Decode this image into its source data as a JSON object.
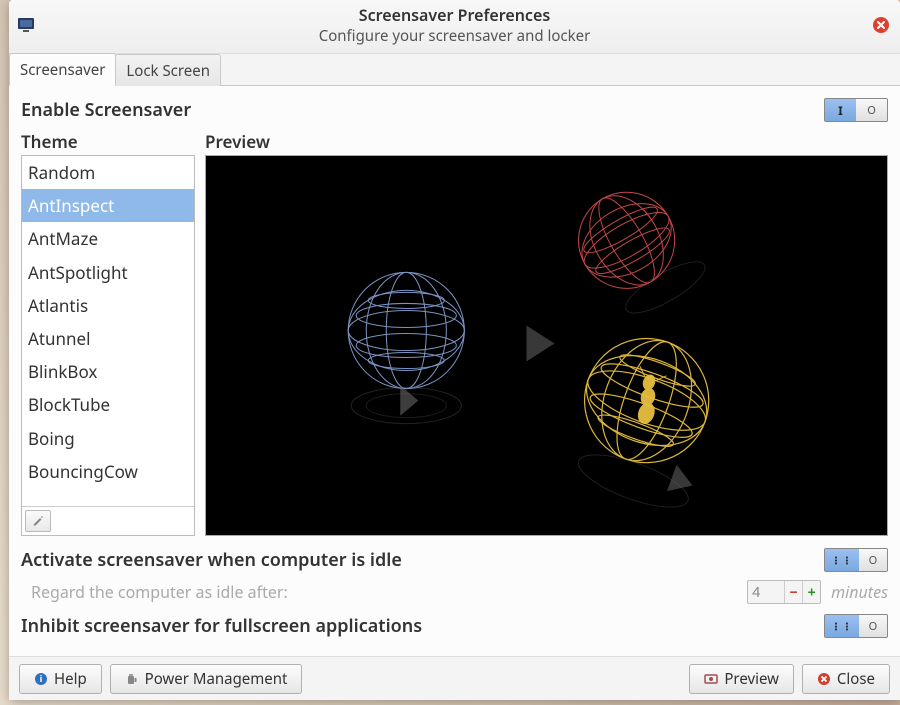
{
  "window": {
    "title": "Screensaver Preferences",
    "subtitle": "Configure your screensaver and locker"
  },
  "tabs": [
    {
      "label": "Screensaver",
      "active": true
    },
    {
      "label": "Lock Screen",
      "active": false
    }
  ],
  "enable": {
    "label": "Enable Screensaver",
    "value": true,
    "on_glyph": "I",
    "off_glyph": "O"
  },
  "theme": {
    "header": "Theme",
    "items": [
      "Random",
      "AntInspect",
      "AntMaze",
      "AntSpotlight",
      "Atlantis",
      "Atunnel",
      "BlinkBox",
      "BlockTube",
      "Boing",
      "BouncingCow"
    ],
    "selected_index": 1
  },
  "preview": {
    "header": "Preview"
  },
  "idle": {
    "activate_label": "Activate screensaver when computer is idle",
    "activate_value": false,
    "regard_label": "Regard the computer as idle after:",
    "minutes_value": "4",
    "minutes_unit": "minutes"
  },
  "inhibit": {
    "label": "Inhibit screensaver for fullscreen applications",
    "value": false
  },
  "footer": {
    "help": "Help",
    "power": "Power Management",
    "preview": "Preview",
    "close": "Close"
  },
  "icons": {
    "app": "monitor-icon",
    "close_window": "close-icon",
    "settings_small": "settings-icon",
    "help": "help-icon",
    "power": "power-icon",
    "preview": "preview-icon",
    "close_btn": "close-icon"
  }
}
